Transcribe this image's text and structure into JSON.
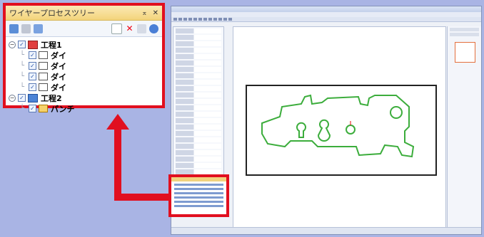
{
  "panel": {
    "title": "ワイヤープロセスツリー",
    "pin": "⌅",
    "close": "✕",
    "tree": [
      {
        "label": "工程1"
      },
      {
        "label": "ダイ"
      },
      {
        "label": "ダイ"
      },
      {
        "label": "ダイ"
      },
      {
        "label": "ダイ"
      },
      {
        "label": "工程2"
      },
      {
        "label": "パンチ"
      }
    ]
  },
  "colors": {
    "highlight": "#e10f1f",
    "background": "#a9b4e4",
    "part_outline": "#3cad3c"
  }
}
